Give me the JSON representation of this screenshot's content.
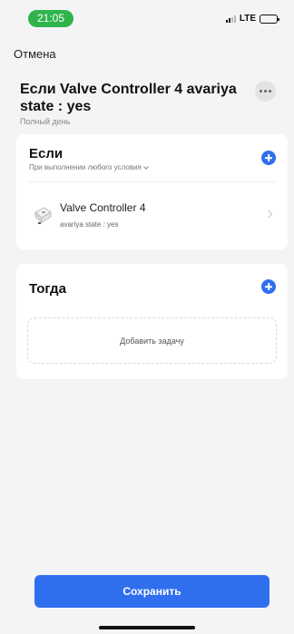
{
  "status_bar": {
    "time": "21:05",
    "network": "LTE",
    "time_pill_color": "#2fb44b",
    "battery_level": 0.55
  },
  "header": {
    "cancel_label": "Отмена",
    "title": "Если Valve Controller 4 avariya state : yes",
    "schedule": "Полный день",
    "more_icon": "more-horizontal-icon"
  },
  "if_section": {
    "heading": "Если",
    "condition_mode": "При выполнении любого условия",
    "conditions": [
      {
        "device": "Valve Controller 4",
        "detail": "avariya state : yes",
        "icon": "valve-controller-device-icon"
      }
    ]
  },
  "then_section": {
    "heading": "Тогда",
    "add_task_label": "Добавить задачу"
  },
  "footer": {
    "save_label": "Сохранить"
  },
  "colors": {
    "accent": "#2f6fee",
    "background": "#f4f4f6",
    "card": "#ffffff"
  }
}
